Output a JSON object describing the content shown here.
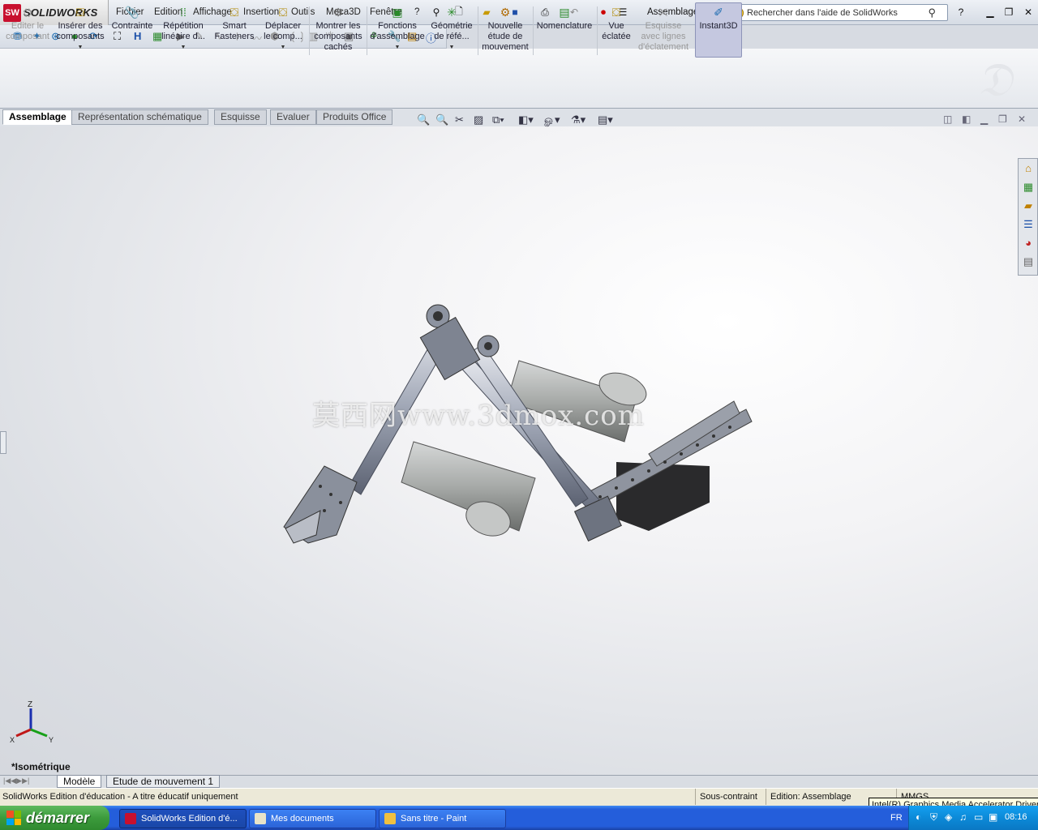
{
  "app": {
    "logo_badge": "SW",
    "logo_text": "SOLIDWORKS",
    "document_title": "Assemblage bras *"
  },
  "menu": [
    "Fichier",
    "Edition",
    "Affichage",
    "Insertion",
    "Outils",
    "Meca3D",
    "Fenêtre",
    "?"
  ],
  "search": {
    "placeholder": "Rechercher dans l'aide de SolidWorks"
  },
  "ribbon": {
    "edit_component": "Editer le\ncomposant",
    "insert_components": "Insérer des\ncomposants",
    "mate": "Contrainte",
    "linear_pattern": "Répétition\nlinéaire d...",
    "smart_fasteners": "Smart\nFasteners",
    "move_component": "Déplacer\nle comp...",
    "show_hidden": "Montrer les\ncomposants\ncachés",
    "assembly_features": "Fonctions\nd'assemblage",
    "reference_geometry": "Géométrie\nde réfé...",
    "new_motion_study": "Nouvelle\nétude de\nmouvement",
    "bom": "Nomenclature",
    "exploded_view": "Vue\néclatée",
    "explode_line_sketch": "Esquisse\navec lignes\nd'éclatement",
    "instant3d": "Instant3D"
  },
  "tabs": [
    "Assemblage",
    "Représentation schématique",
    "Esquisse",
    "Evaluer",
    "Produits Office"
  ],
  "viewport": {
    "view_name": "*Isométrique",
    "watermark": "莫西网www.3dmox.com",
    "triad": {
      "x": "X",
      "y": "Y",
      "z": "Z"
    }
  },
  "bottom_tabs": [
    "Modèle",
    "Etude de mouvement 1"
  ],
  "status": {
    "left": "SolidWorks Edition d'éducation - A titre éducatif uniquement",
    "constraint": "Sous-contraint",
    "edition": "Edition: Assemblage",
    "units": "MMGS",
    "tooltip": "Intel(R) Graphics Media Accelerator Driver"
  },
  "taskbar": {
    "start": "démarrer",
    "items": [
      "SolidWorks Edition d'é...",
      "Mes documents",
      "Sans titre - Paint"
    ],
    "lang": "FR",
    "clock": "08:16"
  }
}
